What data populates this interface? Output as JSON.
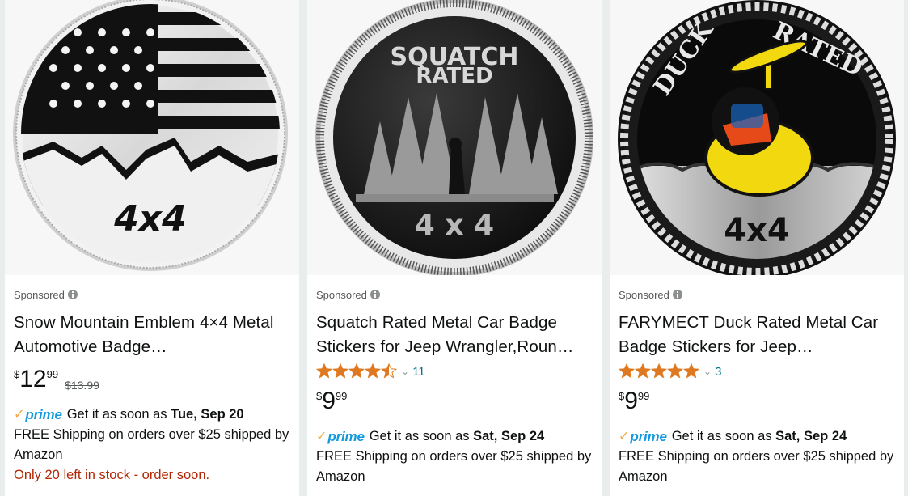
{
  "products": [
    {
      "sponsored": "Sponsored",
      "title": "Snow Mountain Emblem 4×4 Metal Automotive Badge…",
      "badge_text": "4x4",
      "price_symbol": "$",
      "price_whole": "12",
      "price_fraction": "99",
      "list_price": "$13.99",
      "prime_label": "prime",
      "delivery_prefix": "Get it as soon as",
      "delivery_date": "Tue, Sep 20",
      "shipping": "FREE Shipping on orders over $25 shipped by Amazon",
      "stock": "Only 20 left in stock - order soon."
    },
    {
      "sponsored": "Sponsored",
      "title": "Squatch Rated Metal Car Badge Stickers for Jeep Wrangler,Roun…",
      "badge_text_top": "SQUATCH",
      "badge_text_mid": "RATED",
      "badge_text": "4 x 4",
      "rating": 4.5,
      "review_count": "11",
      "price_symbol": "$",
      "price_whole": "9",
      "price_fraction": "99",
      "prime_label": "prime",
      "delivery_prefix": "Get it as soon as",
      "delivery_date": "Sat, Sep 24",
      "shipping": "FREE Shipping on orders over $25 shipped by Amazon"
    },
    {
      "sponsored": "Sponsored",
      "title": "FARYMECT Duck Rated Metal Car Badge Stickers for Jeep…",
      "badge_text_left": "DUCK",
      "badge_text_right": "RATED",
      "badge_text": "4x4",
      "rating": 5,
      "review_count": "3",
      "price_symbol": "$",
      "price_whole": "9",
      "price_fraction": "99",
      "prime_label": "prime",
      "delivery_prefix": "Get it as soon as",
      "delivery_date": "Sat, Sep 24",
      "shipping": "FREE Shipping on orders over $25 shipped by Amazon"
    }
  ],
  "colors": {
    "link": "#007185",
    "star": "#de7921",
    "prime_blue": "#1399e0",
    "prime_check": "#f3a847",
    "stock_red": "#b12704"
  }
}
